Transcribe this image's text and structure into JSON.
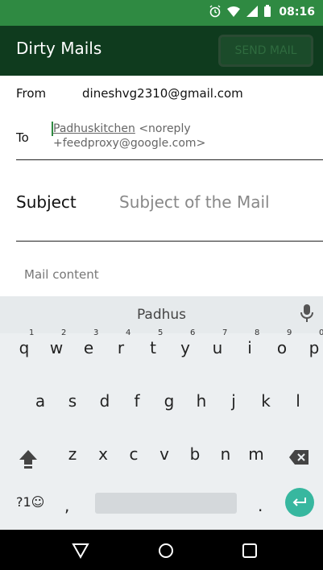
{
  "status_bar": {
    "time": "08:16",
    "icons": [
      "alarm-icon",
      "wifi-icon",
      "signal-icon",
      "battery-icon"
    ]
  },
  "app": {
    "title": "Dirty Mails",
    "send_button": "SEND MAIL"
  },
  "form": {
    "from_label": "From",
    "from_value": "dineshvg2310@gmail.com",
    "to_label": "To",
    "to_name": "Padhuskitchen",
    "to_rest": " <noreply +feedproxy@google.com>",
    "subject_label": "Subject",
    "subject_placeholder": "Subject of the Mail",
    "content_placeholder": "Mail content"
  },
  "keyboard": {
    "suggestion": "Padhus",
    "row1": [
      "q",
      "w",
      "e",
      "r",
      "t",
      "y",
      "u",
      "i",
      "o",
      "p"
    ],
    "row1_hints": [
      "1",
      "2",
      "3",
      "4",
      "5",
      "6",
      "7",
      "8",
      "9",
      "0"
    ],
    "row2": [
      "a",
      "s",
      "d",
      "f",
      "g",
      "h",
      "j",
      "k",
      "l"
    ],
    "row3": [
      "z",
      "x",
      "c",
      "v",
      "b",
      "n",
      "m"
    ],
    "symbols_key": "?1☺",
    "comma_key": ",",
    "period_key": "."
  },
  "colors": {
    "status_bar": "#2f8a42",
    "app_bar": "#0f3b1e",
    "accent": "#37b79f"
  },
  "nav": {
    "buttons": [
      "back-icon",
      "home-icon",
      "recents-icon"
    ]
  }
}
